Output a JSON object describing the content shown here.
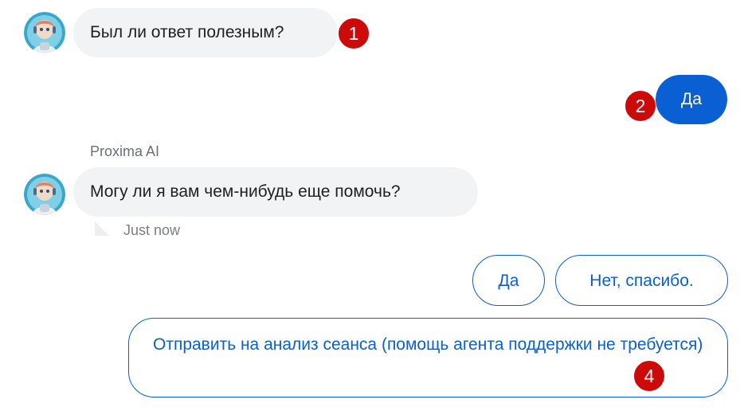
{
  "colors": {
    "accent": "#0a5fd3",
    "bot_bubble": "#f2f3f5",
    "marker": "#cc0a0a"
  },
  "conversation": {
    "message1": {
      "text": "Был ли ответ полезным?",
      "avatar_icon": "robot-avatar-icon"
    },
    "user_reply": {
      "text": "Да"
    },
    "message2": {
      "sender": "Proxima AI",
      "text": "Могу ли я вам чем-нибудь еще помочь?",
      "timestamp": "Just now",
      "avatar_icon": "robot-avatar-icon"
    }
  },
  "quick_replies": [
    {
      "label": "Да"
    },
    {
      "label": "Нет, спасибо."
    },
    {
      "label": "Отправить на анализ сеанса (помощь агента поддержки не требуется)"
    }
  ],
  "markers": [
    "1",
    "2",
    "4"
  ]
}
